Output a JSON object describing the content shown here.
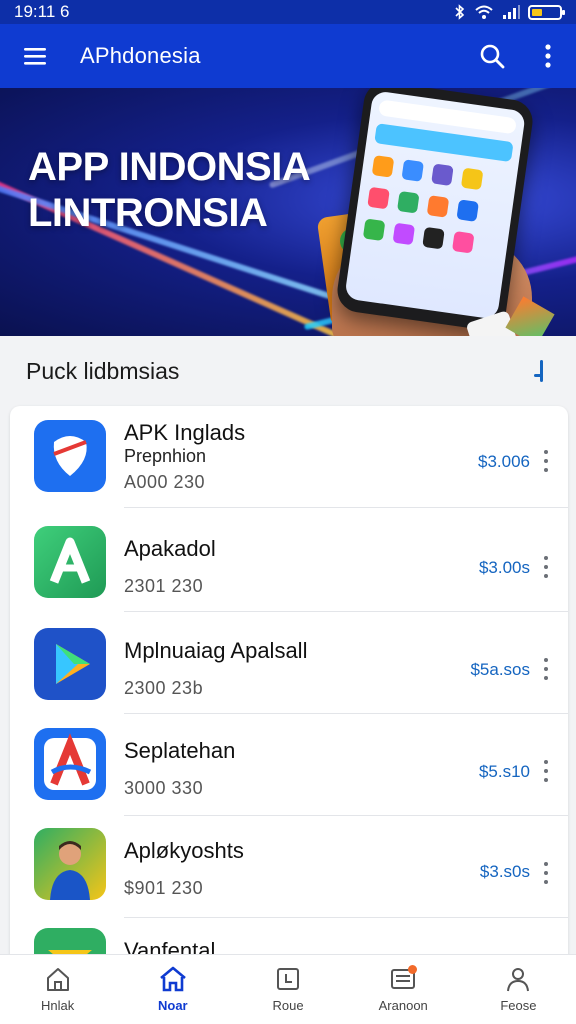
{
  "status_bar": {
    "time": "19:11 6"
  },
  "app_bar": {
    "title": "APhdonesia"
  },
  "banner": {
    "line1": "APP INDONSIA",
    "line2": "LINTRONSIA"
  },
  "section": {
    "title": "Puck lidbmsias"
  },
  "apps": [
    {
      "name": "APK Inglads",
      "subtitle": "Prepnhion",
      "meta": "A000 230",
      "price": "$3.006",
      "icon": "heart-app-icon",
      "color": "#1e6ff0"
    },
    {
      "name": "Apakadol",
      "subtitle": "",
      "meta": "2301 230",
      "price": "$3.00s",
      "icon": "letter-a-app-icon",
      "color": "#2fae62"
    },
    {
      "name": "Mplnuaiag Apalsall",
      "subtitle": "",
      "meta": "2300 23b",
      "price": "$5a.sos",
      "icon": "play-triangle-app-icon",
      "color": "#1f52c8"
    },
    {
      "name": "Seplatehan",
      "subtitle": "",
      "meta": "3000 330",
      "price": "$5.s10",
      "icon": "letter-a-red-app-icon",
      "color": "#1e6ff0"
    },
    {
      "name": "Apløkyoshts",
      "subtitle": "",
      "meta": "$901 230",
      "price": "$3.s0s",
      "icon": "person-app-icon",
      "color": "#2a8a4a"
    },
    {
      "name": "Vanfental",
      "subtitle": "",
      "meta": "",
      "price": "",
      "icon": "envelope-app-icon",
      "color": "#2fae62"
    }
  ],
  "bottom_nav": [
    {
      "label": "Hnlak",
      "icon": "home-outline-icon",
      "active": false
    },
    {
      "label": "Noar",
      "icon": "home-icon",
      "active": true
    },
    {
      "label": "Roue",
      "icon": "calendar-icon",
      "active": false
    },
    {
      "label": "Aranoon",
      "icon": "inbox-icon",
      "active": false
    },
    {
      "label": "Feose",
      "icon": "person-icon",
      "active": false
    }
  ],
  "colors": {
    "app_bar": "#0f3bd1",
    "status_bar": "#0d2fa8",
    "accent": "#1565c0"
  }
}
